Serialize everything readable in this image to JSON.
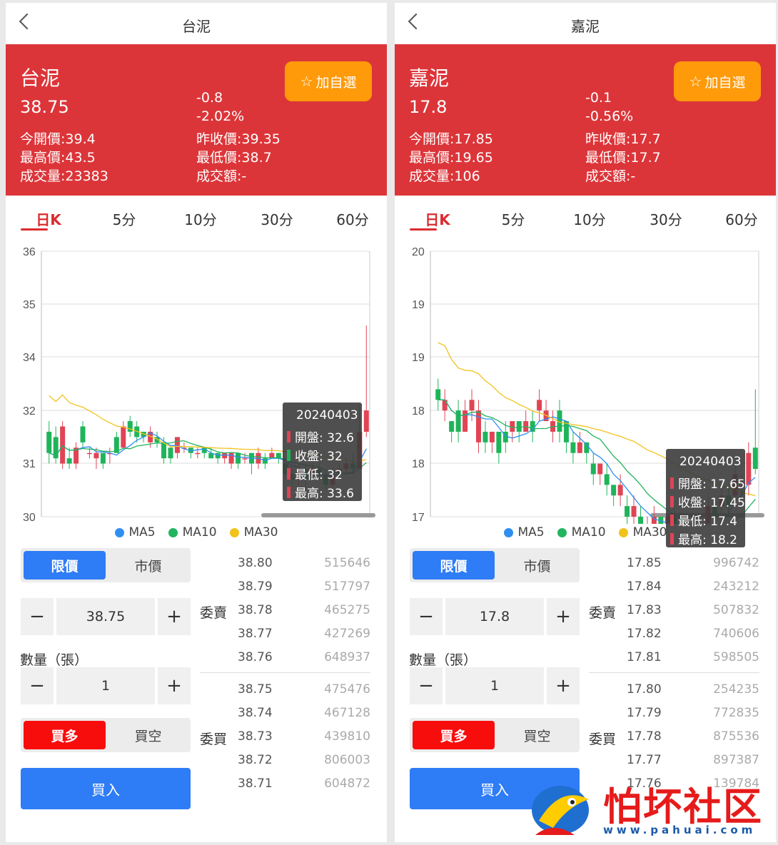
{
  "panels": [
    {
      "nav_title": "台泥",
      "name": "台泥",
      "price": "38.75",
      "change": "-0.8",
      "change_pct": "-2.02%",
      "open": "今開價:39.4",
      "prev_close": "昨收價:39.35",
      "high": "最高價:43.5",
      "low": "最低價:38.7",
      "volume": "成交量:23383",
      "amount": "成交額:-",
      "fav_label": "加自選",
      "tabs": [
        "日K",
        "5分",
        "10分",
        "30分",
        "60分"
      ],
      "legend": [
        "MA5",
        "MA10",
        "MA30"
      ],
      "tooltip": {
        "date": "20240403",
        "open": "開盤: 32.6",
        "close": "收盤: 32",
        "low": "最低: 32",
        "high": "最高: 33.6"
      },
      "order_type": {
        "limit": "限價",
        "market": "市價"
      },
      "price_input": "38.75",
      "minus": "−",
      "plus": "+",
      "qty_label": "數量（張）",
      "qty_input": "1",
      "direction": {
        "long": "買多",
        "short": "買空"
      },
      "buy_label": "買入",
      "sell_side_label": "委賣",
      "buy_side_label": "委買",
      "asks": [
        [
          "38.80",
          "515646"
        ],
        [
          "38.79",
          "517797"
        ],
        [
          "38.78",
          "465275"
        ],
        [
          "38.77",
          "427269"
        ],
        [
          "38.76",
          "648937"
        ]
      ],
      "bids": [
        [
          "38.75",
          "475476"
        ],
        [
          "38.74",
          "467128"
        ],
        [
          "38.73",
          "439810"
        ],
        [
          "38.72",
          "806003"
        ],
        [
          "38.71",
          "604872"
        ]
      ]
    },
    {
      "nav_title": "嘉泥",
      "name": "嘉泥",
      "price": "17.8",
      "change": "-0.1",
      "change_pct": "-0.56%",
      "open": "今開價:17.85",
      "prev_close": "昨收價:17.7",
      "high": "最高價:19.65",
      "low": "最低價:17.7",
      "volume": "成交量:106",
      "amount": "成交額:-",
      "fav_label": "加自選",
      "tabs": [
        "日K",
        "5分",
        "10分",
        "30分",
        "60分"
      ],
      "legend": [
        "MA5",
        "MA10",
        "MA30"
      ],
      "tooltip": {
        "date": "20240403",
        "open": "開盤: 17.65",
        "close": "收盤: 17.45",
        "low": "最低: 17.4",
        "high": "最高: 18.2"
      },
      "order_type": {
        "limit": "限價",
        "market": "市價"
      },
      "price_input": "17.8",
      "minus": "−",
      "plus": "+",
      "qty_label": "數量（張）",
      "qty_input": "1",
      "direction": {
        "long": "買多",
        "short": "買空"
      },
      "buy_label": "買入",
      "sell_side_label": "委賣",
      "buy_side_label": "委買",
      "asks": [
        [
          "17.85",
          "996742"
        ],
        [
          "17.84",
          "243212"
        ],
        [
          "17.83",
          "507832"
        ],
        [
          "17.82",
          "740606"
        ],
        [
          "17.81",
          "598505"
        ]
      ],
      "bids": [
        [
          "17.80",
          "254235"
        ],
        [
          "17.79",
          "772835"
        ],
        [
          "17.78",
          "875536"
        ],
        [
          "17.77",
          "897387"
        ],
        [
          "17.76",
          "139784"
        ]
      ]
    }
  ],
  "colors": {
    "header_red": "#dc3539",
    "fav_orange": "#ff9a0a",
    "accent_blue": "#2e7cf6",
    "up_red": "#e04455",
    "down_green": "#1fb45a",
    "ma5": "#2f8ff0",
    "ma10": "#22b45e",
    "ma30": "#f2c21b"
  },
  "watermark": {
    "text": "怕坏社区",
    "url": "www.pahuai.com"
  },
  "chart_data": [
    {
      "type": "candlestick",
      "yticks": [
        "36",
        "35",
        "34",
        "32",
        "31",
        "30"
      ],
      "ylim": [
        30,
        35
      ],
      "candles": [
        [
          31.6,
          31.2,
          31.8,
          31.0
        ],
        [
          31.5,
          31.1,
          31.7,
          31.0
        ],
        [
          31.0,
          31.7,
          31.8,
          30.9
        ],
        [
          31.1,
          31.0,
          31.3,
          30.9
        ],
        [
          31.0,
          31.3,
          31.4,
          30.9
        ],
        [
          31.7,
          31.4,
          31.8,
          31.3
        ],
        [
          31.2,
          31.2,
          31.3,
          31.1
        ],
        [
          31.1,
          31.2,
          31.3,
          30.9
        ],
        [
          31.2,
          31.0,
          31.2,
          30.9
        ],
        [
          31.2,
          31.2,
          31.3,
          31.0
        ],
        [
          31.5,
          31.2,
          31.6,
          31.2
        ],
        [
          31.3,
          31.7,
          31.8,
          31.3
        ],
        [
          31.8,
          31.6,
          31.9,
          31.5
        ],
        [
          31.7,
          31.5,
          31.8,
          31.4
        ],
        [
          31.6,
          31.5,
          31.6,
          31.4
        ],
        [
          31.4,
          31.6,
          31.7,
          31.3
        ],
        [
          31.5,
          31.4,
          31.6,
          31.3
        ],
        [
          31.4,
          31.1,
          31.5,
          31.0
        ],
        [
          31.3,
          31.1,
          31.3,
          31.0
        ],
        [
          31.2,
          31.5,
          31.5,
          31.1
        ],
        [
          31.3,
          31.3,
          31.4,
          31.2
        ],
        [
          31.3,
          31.2,
          31.3,
          31.1
        ],
        [
          31.2,
          31.2,
          31.3,
          31.1
        ],
        [
          31.3,
          31.2,
          31.3,
          31.1
        ],
        [
          31.2,
          31.1,
          31.3,
          31.1
        ],
        [
          31.2,
          31.1,
          31.2,
          31.0
        ],
        [
          31.1,
          31.2,
          31.2,
          31.0
        ],
        [
          31.0,
          31.2,
          31.2,
          30.9
        ],
        [
          31.2,
          31.0,
          31.2,
          30.9
        ],
        [
          31.1,
          31.1,
          31.2,
          31.0
        ],
        [
          31.2,
          31.0,
          31.2,
          30.8
        ],
        [
          31.0,
          31.2,
          31.3,
          30.9
        ],
        [
          31.1,
          31.0,
          31.2,
          30.9
        ],
        [
          31.1,
          31.2,
          31.3,
          31.1
        ],
        [
          31.2,
          31.1,
          31.2,
          31.0
        ],
        [
          31.0,
          30.8,
          31.1,
          30.7
        ],
        [
          30.8,
          30.7,
          30.9,
          30.6
        ],
        [
          30.7,
          30.9,
          31.0,
          30.6
        ],
        [
          30.9,
          30.7,
          31.0,
          30.5
        ],
        [
          30.8,
          30.9,
          31.0,
          30.7
        ],
        [
          30.9,
          30.8,
          31.0,
          30.7
        ],
        [
          30.8,
          30.6,
          30.9,
          30.5
        ],
        [
          30.6,
          30.8,
          30.9,
          30.5
        ],
        [
          30.8,
          30.9,
          31.0,
          30.7
        ],
        [
          30.9,
          31.0,
          31.1,
          30.8
        ],
        [
          31.0,
          30.9,
          31.2,
          30.8
        ],
        [
          30.9,
          31.6,
          32.1,
          30.9
        ],
        [
          31.6,
          32.0,
          33.6,
          31.5
        ]
      ]
    },
    {
      "type": "candlestick",
      "yticks": [
        "20",
        "19",
        "19",
        "18",
        "18",
        "17"
      ],
      "ylim": [
        17,
        19.5
      ],
      "candles": [
        [
          18.2,
          18.1,
          18.3,
          18.0
        ],
        [
          18.0,
          18.1,
          18.2,
          17.9
        ],
        [
          17.9,
          17.8,
          17.9,
          17.7
        ],
        [
          18.0,
          17.8,
          18.1,
          17.7
        ],
        [
          17.8,
          18.0,
          18.1,
          17.8
        ],
        [
          18.0,
          18.1,
          18.2,
          17.9
        ],
        [
          17.7,
          18.0,
          18.1,
          17.6
        ],
        [
          17.8,
          17.7,
          17.9,
          17.6
        ],
        [
          17.7,
          17.8,
          17.8,
          17.6
        ],
        [
          17.8,
          17.6,
          17.8,
          17.5
        ],
        [
          17.8,
          17.7,
          17.9,
          17.6
        ],
        [
          17.8,
          17.9,
          17.9,
          17.7
        ],
        [
          17.9,
          17.8,
          17.9,
          17.7
        ],
        [
          17.8,
          17.9,
          18.0,
          17.8
        ],
        [
          17.9,
          17.8,
          18.0,
          17.7
        ],
        [
          18.0,
          18.1,
          18.2,
          17.9
        ],
        [
          17.9,
          18.0,
          18.1,
          17.9
        ],
        [
          17.8,
          17.9,
          18.0,
          17.7
        ],
        [
          18.0,
          17.8,
          18.1,
          17.7
        ],
        [
          17.9,
          17.7,
          17.9,
          17.6
        ],
        [
          17.7,
          17.6,
          17.8,
          17.5
        ],
        [
          17.6,
          17.7,
          17.8,
          17.6
        ],
        [
          17.7,
          17.6,
          17.7,
          17.5
        ],
        [
          17.5,
          17.4,
          17.6,
          17.3
        ],
        [
          17.4,
          17.5,
          17.5,
          17.3
        ],
        [
          17.4,
          17.3,
          17.5,
          17.2
        ],
        [
          17.3,
          17.2,
          17.3,
          17.1
        ],
        [
          17.2,
          17.3,
          17.4,
          17.1
        ],
        [
          17.1,
          17.0,
          17.2,
          16.9
        ],
        [
          17.0,
          17.1,
          17.2,
          16.9
        ],
        [
          17.0,
          16.9,
          17.1,
          16.8
        ],
        [
          16.9,
          16.9,
          17.0,
          16.8
        ],
        [
          16.9,
          17.0,
          17.1,
          16.8
        ],
        [
          17.0,
          16.9,
          17.0,
          16.8
        ],
        [
          16.8,
          17.0,
          17.0,
          16.7
        ],
        [
          17.0,
          16.9,
          17.1,
          16.8
        ],
        [
          16.9,
          16.8,
          17.0,
          16.7
        ],
        [
          16.8,
          16.7,
          16.9,
          16.6
        ],
        [
          16.7,
          16.8,
          16.9,
          16.6
        ],
        [
          16.8,
          16.7,
          16.9,
          16.6
        ],
        [
          16.9,
          17.1,
          17.2,
          16.8
        ],
        [
          17.1,
          17.0,
          17.2,
          16.9
        ],
        [
          17.1,
          17.2,
          17.3,
          17.0
        ],
        [
          17.2,
          17.1,
          17.3,
          17.0
        ],
        [
          17.2,
          17.4,
          17.5,
          17.1
        ],
        [
          17.3,
          17.3,
          17.4,
          17.2
        ],
        [
          17.3,
          17.6,
          17.7,
          17.2
        ],
        [
          17.65,
          17.45,
          18.2,
          17.4
        ]
      ]
    }
  ]
}
